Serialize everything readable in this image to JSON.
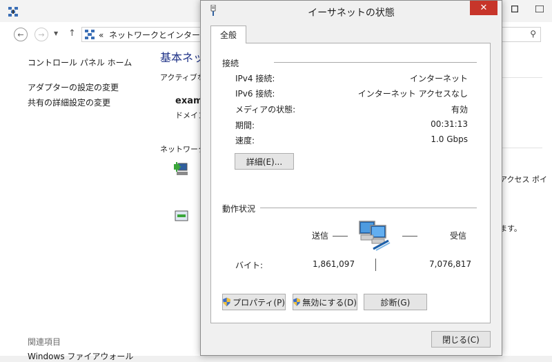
{
  "background_window": {
    "address": {
      "chevron": "«",
      "path": "ネットワークとインターネット"
    },
    "left_pane": {
      "home": "コントロール パネル ホーム",
      "adapter": "アダプターの設定の変更",
      "sharing": "共有の詳細設定の変更",
      "related_title": "関連項目",
      "related_more": "Windows ファイアウォール"
    },
    "main_peek": {
      "title": "基本ネットワーク情報の表示と接続のセットアップ",
      "active": "アクティブなネットワークの表示",
      "network_name": "example.com",
      "network_sub": "ドメイン ネットワーク",
      "net_settings": "ネットワーク設定の変更"
    },
    "right_peek": {
      "line1": "アクセス ポイ",
      "line2": "ます。"
    }
  },
  "dialog": {
    "title": "イーサネットの状態",
    "close_glyph": "✕",
    "tab_label": "全般",
    "connection": {
      "heading": "接続",
      "rows": [
        {
          "label": "IPv4 接続:",
          "value": "インターネット"
        },
        {
          "label": "IPv6 接続:",
          "value": "インターネット アクセスなし"
        },
        {
          "label": "メディアの状態:",
          "value": "有効"
        },
        {
          "label": "期間:",
          "value": "00:31:13"
        },
        {
          "label": "速度:",
          "value": "1.0 Gbps"
        }
      ],
      "details_button": "詳細(E)..."
    },
    "activity": {
      "heading": "動作状況",
      "sent_label": "送信",
      "received_label": "受信",
      "bytes_label": "バイト:",
      "sent_bytes": "1,861,097",
      "received_bytes": "7,076,817"
    },
    "buttons": {
      "properties": "プロパティ(P)",
      "disable": "無効にする(D)",
      "diagnose": "診断(G)",
      "close": "閉じる(C)"
    }
  },
  "colors": {
    "title_close_bg": "#c7352a",
    "link_title": "#1e3287",
    "panel_bg": "#ffffff",
    "dialog_bg": "#f0f0f0"
  },
  "icons": [
    "app-icon",
    "network-icon",
    "back-icon",
    "forward-icon",
    "up-arrow-icon",
    "search-icon",
    "uac-shield-icon",
    "computers-network-icon",
    "close-icon"
  ]
}
